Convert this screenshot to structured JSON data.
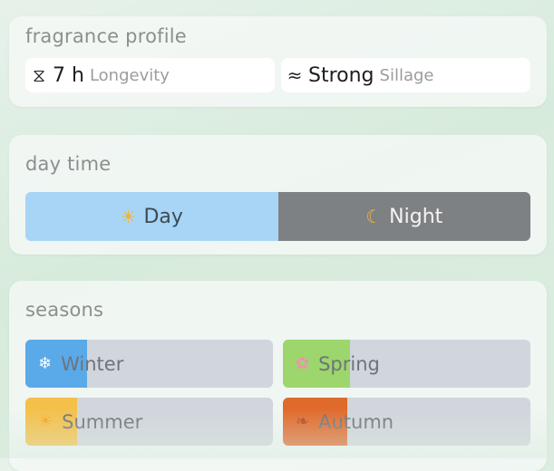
{
  "profile": {
    "title": "fragrance profile",
    "longevity": {
      "icon": "hourglass-icon",
      "glyph": "⧖",
      "value": "7 h",
      "label": "Longevity"
    },
    "sillage": {
      "icon": "waves-icon",
      "glyph": "≈",
      "value": "Strong",
      "label": "Sillage"
    }
  },
  "daytime": {
    "title": "day time",
    "day": {
      "icon": "sun-icon",
      "glyph": "☀",
      "label": "Day",
      "selected": true
    },
    "night": {
      "icon": "moon-icon",
      "glyph": "☾",
      "label": "Night",
      "selected": false
    }
  },
  "seasons": {
    "title": "seasons",
    "items": [
      {
        "id": "winter",
        "icon": "snowflake-icon",
        "glyph": "❄",
        "label": "Winter",
        "level": 0.25,
        "color": "#5aa9e8"
      },
      {
        "id": "spring",
        "icon": "flower-icon",
        "glyph": "✿",
        "label": "Spring",
        "level": 0.27,
        "color": "#9cd66c"
      },
      {
        "id": "summer",
        "icon": "sun-icon",
        "glyph": "☀",
        "label": "Summer",
        "level": 0.21,
        "color": "#f4c04a"
      },
      {
        "id": "autumn",
        "icon": "leaf-icon",
        "glyph": "❧",
        "label": "Autumn",
        "level": 0.26,
        "color": "#e06a2c"
      }
    ]
  }
}
